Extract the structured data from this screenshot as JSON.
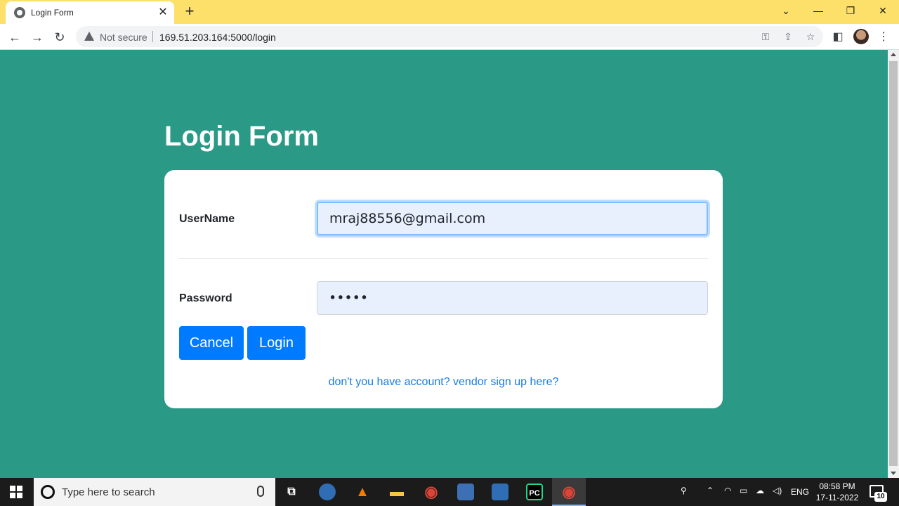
{
  "browser": {
    "tab_title": "Login Form",
    "tab_close": "✕",
    "new_tab": "+",
    "window_controls": {
      "dropdown": "⌄",
      "minimize": "—",
      "restore": "❐",
      "close": "✕"
    },
    "security_label": "Not secure",
    "url": "169.51.203.164:5000/login",
    "nav": {
      "back": "←",
      "forward": "→",
      "reload": "↻"
    },
    "omnibox_icons": {
      "key": "⚿",
      "share": "⇪",
      "star": "☆"
    },
    "toolbar_icons": {
      "sidebar": "◧",
      "menu": "⋮"
    }
  },
  "page": {
    "title": "Login Form",
    "username_label": "UserName",
    "username_value": "mraj88556@gmail.com",
    "password_label": "Password",
    "password_value": "•••••",
    "cancel_label": "Cancel",
    "login_label": "Login",
    "signup_link": "don't you have account? vendor sign up here?"
  },
  "taskbar": {
    "search_placeholder": "Type here to search",
    "language": "ENG",
    "time": "08:58 PM",
    "date": "17-11-2022",
    "notification_count": "10",
    "apps": [
      {
        "name": "task-view",
        "glyph": "⧉",
        "color": "#1b1b1b"
      },
      {
        "name": "vlc",
        "glyph": "▲",
        "color": "#f57c00"
      },
      {
        "name": "file-explorer",
        "glyph": "▬",
        "color": "#f6c544"
      },
      {
        "name": "chrome",
        "glyph": "◉",
        "color": "#db4437"
      },
      {
        "name": "pycharm",
        "glyph": "PC",
        "color": "#21d789"
      },
      {
        "name": "chrome-active",
        "glyph": "◉",
        "color": "#db4437"
      }
    ]
  },
  "colors": {
    "page_background": "#2a9a86",
    "tabstrip": "#fce06a",
    "primary_button": "#007bff",
    "link": "#1a7be0"
  }
}
